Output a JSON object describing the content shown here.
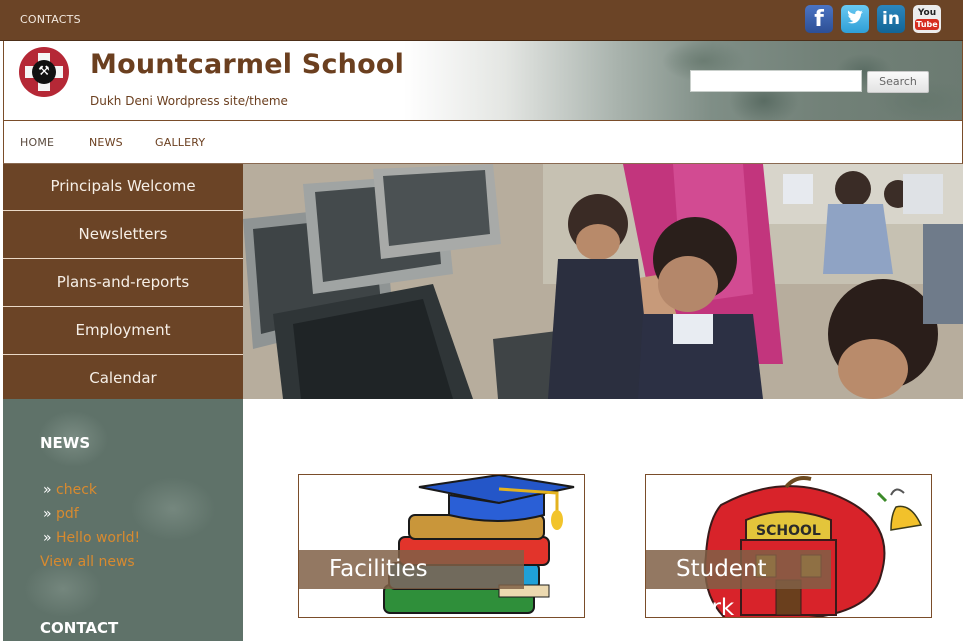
{
  "topbar": {
    "contacts": "CONTACTS",
    "social": {
      "facebook": "f",
      "linkedin": "in",
      "youtube_top": "You",
      "youtube_bottom": "Tube"
    }
  },
  "header": {
    "title": "Mountcarmel School",
    "tagline": "Dukh Deni Wordpress site/theme",
    "search_button": "Search",
    "search_placeholder": ""
  },
  "nav": {
    "items": [
      {
        "label": "HOME"
      },
      {
        "label": "NEWS"
      },
      {
        "label": "GALLERY"
      }
    ]
  },
  "side_menu": {
    "items": [
      {
        "label": "Principals Welcome"
      },
      {
        "label": "Newsletters"
      },
      {
        "label": "Plans-and-reports"
      },
      {
        "label": "Employment"
      },
      {
        "label": "Calendar"
      }
    ]
  },
  "sidebar": {
    "news_title": "NEWS",
    "news_items": [
      {
        "bullet": "»",
        "label": "check"
      },
      {
        "bullet": "»",
        "label": "pdf"
      },
      {
        "bullet": "»",
        "label": "Hello world!"
      }
    ],
    "view_all": "View all news",
    "contact_title": "CONTACT"
  },
  "cards": [
    {
      "label": "Facilities"
    },
    {
      "label": "Student Work"
    }
  ],
  "colors": {
    "brand_brown": "#6b4426",
    "title_brown": "#6b3f1f",
    "sidebar_green": "#5f7269",
    "link_orange": "#d88a2f"
  },
  "icons": {
    "logo": "school-logo-icon",
    "facebook": "facebook-icon",
    "twitter": "twitter-icon",
    "linkedin": "linkedin-icon",
    "youtube": "youtube-icon"
  }
}
